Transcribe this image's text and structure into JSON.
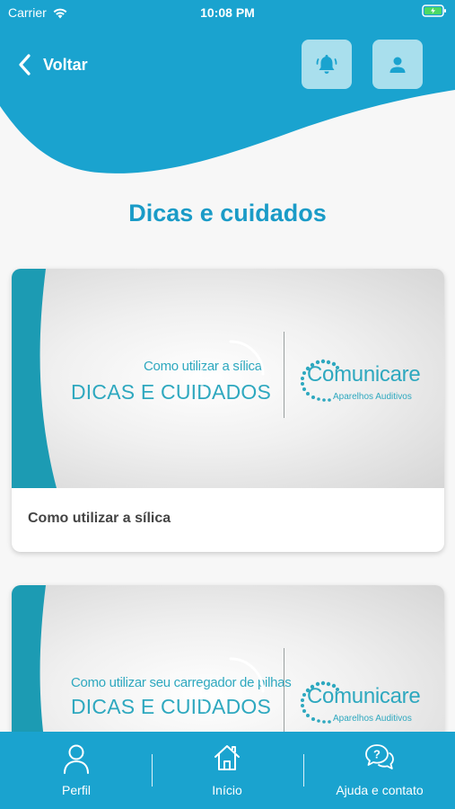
{
  "status_bar": {
    "carrier": "Carrier",
    "time": "10:08 PM"
  },
  "header": {
    "back_label": "Voltar"
  },
  "page": {
    "title": "Dicas e cuidados"
  },
  "cards": [
    {
      "thumb_subtitle": "Como utilizar a sílica",
      "thumb_title": "DICAS E CUIDADOS",
      "brand": "Comunicare",
      "brand_tagline": "Aparelhos Auditivos",
      "caption": "Como utilizar a sílica"
    },
    {
      "thumb_subtitle": "Como utilizar seu carregador de pilhas",
      "thumb_title": "DICAS E CUIDADOS",
      "brand": "Comunicare",
      "brand_tagline": "Aparelhos Auditivos"
    }
  ],
  "tabbar": {
    "tabs": [
      {
        "label": "Perfil",
        "icon": "user-icon"
      },
      {
        "label": "Início",
        "icon": "home-icon"
      },
      {
        "label": "Ajuda e contato",
        "icon": "help-chat-icon"
      }
    ]
  },
  "colors": {
    "primary": "#1aa3cf",
    "title": "#1a9bc7",
    "button_bg": "#a9dfed",
    "teal": "#2ea8bf"
  }
}
